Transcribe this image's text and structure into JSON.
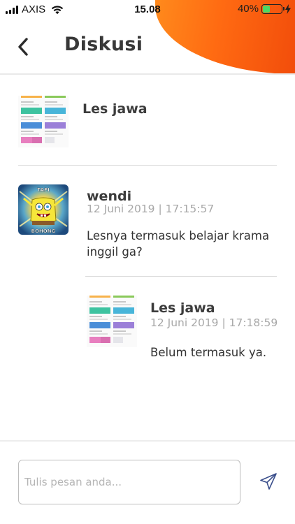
{
  "status_bar": {
    "carrier": "AXIS",
    "time": "15.08",
    "battery_percent": "40%",
    "battery_level": 0.4,
    "battery_color": "#4cd964",
    "icons": [
      "signal-icon",
      "wifi-icon",
      "battery-icon",
      "charging-bolt-icon"
    ]
  },
  "header": {
    "title": "Diskusi",
    "back_icon": "chevron-left-icon",
    "accent_color": "#ff6a12"
  },
  "topic": {
    "title": "Les jawa",
    "thumbnail": "lesson-grid-thumbnail"
  },
  "comments": [
    {
      "author": "wendi",
      "timestamp": "12 Juni 2019 | 17:15:57",
      "message": "Lesnya termasuk belajar krama inggil ga?",
      "avatar": "spongebob-meme-avatar",
      "avatar_text": [
        "TAPI",
        "BOHONG"
      ]
    },
    {
      "author": "Les jawa",
      "timestamp": "12 Juni 2019 | 17:18:59",
      "message": "Belum termasuk ya.",
      "avatar": "lesson-grid-thumbnail"
    }
  ],
  "composer": {
    "placeholder": "Tulis pesan anda...",
    "value": "",
    "send_icon": "send-icon"
  }
}
